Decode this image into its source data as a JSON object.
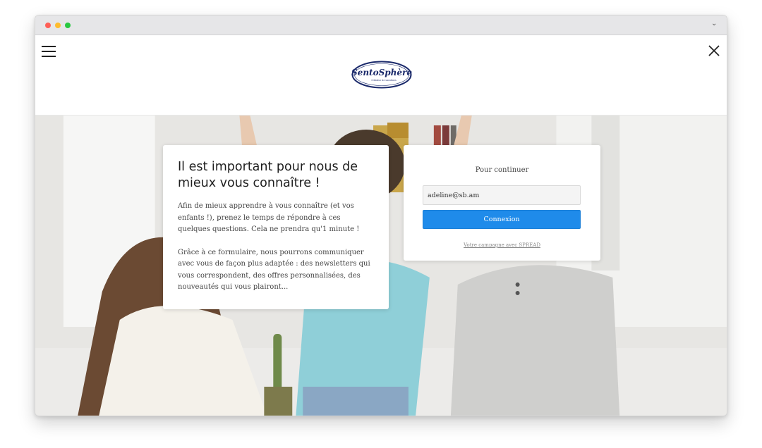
{
  "colors": {
    "accent": "#1f8bea",
    "logo_navy": "#1b2a6b"
  },
  "logo": {
    "brand": "SentoSphère",
    "tagline": "Créateur de vocations"
  },
  "intro": {
    "title": "Il est important pour nous de mieux vous connaître !",
    "paragraph1": "Afin de mieux apprendre à vous connaître (et vos enfants !), prenez le temps de répondre à ces quelques questions. Cela ne prendra qu'1 minute !",
    "paragraph2": "Grâce à ce formulaire, nous pourrons communiquer avec vous de façon plus adaptée : des newsletters qui vous correspondent, des offres personnalisées, des nouveautés qui vous plairont..."
  },
  "login": {
    "title": "Pour continuer",
    "email_value": "adeline@sb.am",
    "button_label": "Connexion",
    "footer_link": "Votre campagne avec SPREAD"
  },
  "icons": {
    "menu": "hamburger-icon",
    "close": "close-icon",
    "chevron": "chevron-down-icon"
  }
}
